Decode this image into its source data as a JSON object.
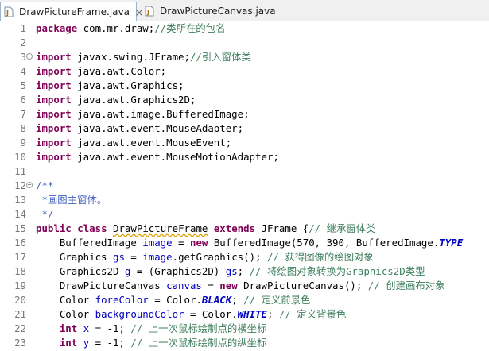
{
  "tabs": [
    {
      "label": "DrawPictureFrame.java",
      "active": true,
      "icon": "java-file-icon"
    },
    {
      "label": "DrawPictureCanvas.java",
      "active": false,
      "icon": "java-file-icon"
    }
  ],
  "colors": {
    "keyword": "#7f0055",
    "comment": "#3f7f5f",
    "javadoc": "#3f5fbf",
    "field": "#0000c0",
    "line_number": "#787878"
  },
  "lines": [
    {
      "num": "1",
      "fold": "",
      "tokens": [
        {
          "t": "package",
          "c": "kw"
        },
        {
          "t": " com.mr.draw;"
        },
        {
          "t": "//类所在的包名",
          "c": "cm"
        }
      ]
    },
    {
      "num": "2",
      "fold": "",
      "tokens": []
    },
    {
      "num": "3",
      "fold": "−",
      "tokens": [
        {
          "t": "import",
          "c": "kw"
        },
        {
          "t": " javax.swing.JFrame;"
        },
        {
          "t": "//引入窗体类",
          "c": "cm"
        }
      ]
    },
    {
      "num": "4",
      "fold": "",
      "tokens": [
        {
          "t": "import",
          "c": "kw"
        },
        {
          "t": " java.awt.Color;"
        }
      ]
    },
    {
      "num": "5",
      "fold": "",
      "tokens": [
        {
          "t": "import",
          "c": "kw"
        },
        {
          "t": " java.awt.Graphics;"
        }
      ]
    },
    {
      "num": "6",
      "fold": "",
      "tokens": [
        {
          "t": "import",
          "c": "kw"
        },
        {
          "t": " java.awt.Graphics2D;"
        }
      ]
    },
    {
      "num": "7",
      "fold": "",
      "tokens": [
        {
          "t": "import",
          "c": "kw"
        },
        {
          "t": " java.awt.image.BufferedImage;"
        }
      ]
    },
    {
      "num": "8",
      "fold": "",
      "tokens": [
        {
          "t": "import",
          "c": "kw"
        },
        {
          "t": " java.awt.event.MouseAdapter;"
        }
      ]
    },
    {
      "num": "9",
      "fold": "",
      "tokens": [
        {
          "t": "import",
          "c": "kw"
        },
        {
          "t": " java.awt.event.MouseEvent;"
        }
      ]
    },
    {
      "num": "10",
      "fold": "",
      "tokens": [
        {
          "t": "import",
          "c": "kw"
        },
        {
          "t": " java.awt.event.MouseMotionAdapter;"
        }
      ]
    },
    {
      "num": "11",
      "fold": "",
      "tokens": []
    },
    {
      "num": "12",
      "fold": "−",
      "tokens": [
        {
          "t": "/**",
          "c": "jd"
        }
      ]
    },
    {
      "num": "13",
      "fold": "",
      "tokens": [
        {
          "t": " *画图主窗体。",
          "c": "jd"
        }
      ]
    },
    {
      "num": "14",
      "fold": "",
      "tokens": [
        {
          "t": " */",
          "c": "jd"
        }
      ]
    },
    {
      "num": "15",
      "fold": "",
      "tokens": [
        {
          "t": "public",
          "c": "kw"
        },
        {
          "t": " "
        },
        {
          "t": "class",
          "c": "kw"
        },
        {
          "t": " "
        },
        {
          "t": "DrawPictureFrame",
          "c": "warn"
        },
        {
          "t": " "
        },
        {
          "t": "extends",
          "c": "kw"
        },
        {
          "t": " JFrame {"
        },
        {
          "t": "// 继承窗体类",
          "c": "cm"
        }
      ]
    },
    {
      "num": "16",
      "fold": "",
      "tokens": [
        {
          "t": "    BufferedImage "
        },
        {
          "t": "image",
          "c": "fld"
        },
        {
          "t": " = "
        },
        {
          "t": "new",
          "c": "kw"
        },
        {
          "t": " BufferedImage(570, 390, BufferedImage."
        },
        {
          "t": "TYPE",
          "c": "sfld"
        }
      ]
    },
    {
      "num": "17",
      "fold": "",
      "tokens": [
        {
          "t": "    Graphics "
        },
        {
          "t": "gs",
          "c": "fld"
        },
        {
          "t": " = "
        },
        {
          "t": "image",
          "c": "fld"
        },
        {
          "t": ".getGraphics(); "
        },
        {
          "t": "// 获得图像的绘图对象",
          "c": "cm"
        }
      ]
    },
    {
      "num": "18",
      "fold": "",
      "tokens": [
        {
          "t": "    Graphics2D "
        },
        {
          "t": "g",
          "c": "fld"
        },
        {
          "t": " = (Graphics2D) "
        },
        {
          "t": "gs",
          "c": "fld"
        },
        {
          "t": "; "
        },
        {
          "t": "// 将绘图对象转换为Graphics2D类型",
          "c": "cm"
        }
      ]
    },
    {
      "num": "19",
      "fold": "",
      "tokens": [
        {
          "t": "    DrawPictureCanvas "
        },
        {
          "t": "canvas",
          "c": "fld"
        },
        {
          "t": " = "
        },
        {
          "t": "new",
          "c": "kw"
        },
        {
          "t": " DrawPictureCanvas(); "
        },
        {
          "t": "// 创建画布对象",
          "c": "cm"
        }
      ]
    },
    {
      "num": "20",
      "fold": "",
      "tokens": [
        {
          "t": "    Color "
        },
        {
          "t": "foreColor",
          "c": "fld"
        },
        {
          "t": " = Color."
        },
        {
          "t": "BLACK",
          "c": "sfld"
        },
        {
          "t": "; "
        },
        {
          "t": "// 定义前景色",
          "c": "cm"
        }
      ]
    },
    {
      "num": "21",
      "fold": "",
      "tokens": [
        {
          "t": "    Color "
        },
        {
          "t": "backgroundColor",
          "c": "fld"
        },
        {
          "t": " = Color."
        },
        {
          "t": "WHITE",
          "c": "sfld"
        },
        {
          "t": "; "
        },
        {
          "t": "// 定义背景色",
          "c": "cm"
        }
      ]
    },
    {
      "num": "22",
      "fold": "",
      "tokens": [
        {
          "t": "    "
        },
        {
          "t": "int",
          "c": "kw"
        },
        {
          "t": " "
        },
        {
          "t": "x",
          "c": "fld"
        },
        {
          "t": " = -1; "
        },
        {
          "t": "// 上一次鼠标绘制点的横坐标",
          "c": "cm"
        }
      ]
    },
    {
      "num": "23",
      "fold": "",
      "tokens": [
        {
          "t": "    "
        },
        {
          "t": "int",
          "c": "kw"
        },
        {
          "t": " "
        },
        {
          "t": "y",
          "c": "fld"
        },
        {
          "t": " = -1; "
        },
        {
          "t": "// 上一次鼠标绘制点的纵坐标",
          "c": "cm"
        }
      ]
    }
  ]
}
